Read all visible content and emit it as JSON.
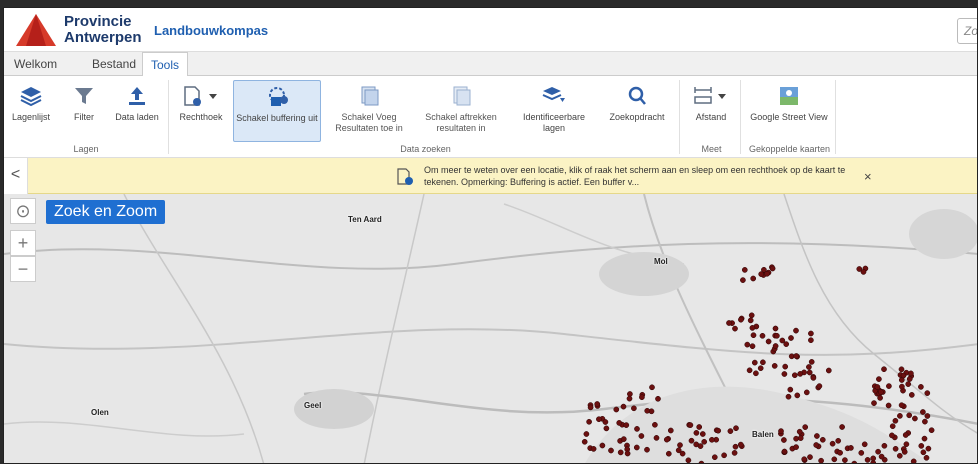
{
  "header": {
    "brand_line1": "Provincie",
    "brand_line2": "Antwerpen",
    "app_title": "Landbouwkompas",
    "search_placeholder": "Zoe"
  },
  "tabs": [
    {
      "label": "Welkom"
    },
    {
      "label": "Bestand"
    },
    {
      "label": "Tools"
    }
  ],
  "ribbon": {
    "groups": {
      "lagen": "Lagen",
      "data_zoeken": "Data zoeken",
      "meet": "Meet",
      "gekoppelde": "Gekoppelde kaarten"
    },
    "tools": {
      "lagenlijst": "Lagenlijst",
      "filter": "Filter",
      "data_laden": "Data laden",
      "rechthoek": "Rechthoek",
      "schakel_buffering": "Schakel buffering uit",
      "schakel_voeg": "Schakel Voeg Resultaten toe in",
      "schakel_aftrekken": "Schakel aftrekken resultaten in",
      "identificeerbare": "Identificeerbare lagen",
      "zoekopdracht": "Zoekopdracht",
      "afstand": "Afstand",
      "street_view": "Google Street View"
    }
  },
  "notice": {
    "text": "Om meer te weten over een locatie, klik of raak het scherm aan en sleep om een rechthoek op de kaart te tekenen. Opmerking: Buffering is actief. Een buffer v...",
    "close": "×",
    "back": "<"
  },
  "map": {
    "zoek_en_zoom": "Zoek en Zoom",
    "zoom_in": "+",
    "zoom_out": "−",
    "places": {
      "ten_aard": "Ten Aard",
      "mol": "Mol",
      "geel": "Geel",
      "olen": "Olen",
      "balen": "Balen"
    }
  },
  "colors": {
    "brand_blue": "#1d3a6b",
    "accent_blue": "#1f6fd1",
    "marker": "#6b1010",
    "notice_bg": "#fbf3c4"
  }
}
